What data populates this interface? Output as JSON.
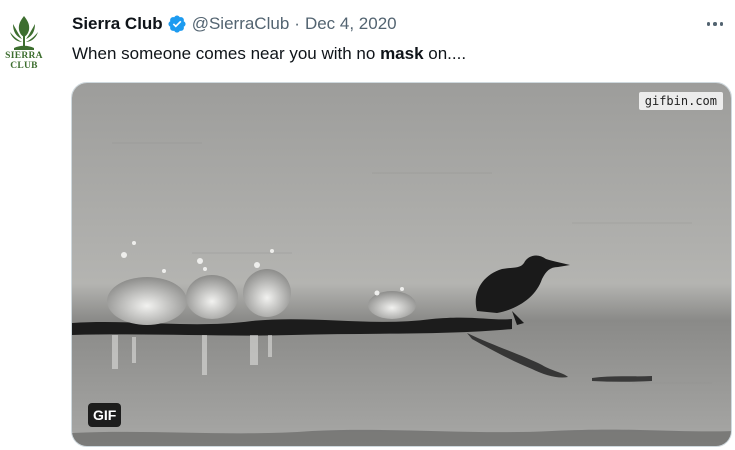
{
  "account": {
    "logo_line1": "SIERRA",
    "logo_line2": "CLUB",
    "name": "Sierra Club",
    "verified_icon": "verified-badge-icon",
    "handle": "@SierraClub",
    "separator": "·",
    "date": "Dec 4, 2020"
  },
  "tweet": {
    "text_before": "When someone comes near you with no ",
    "text_bold": "mask",
    "text_after": " on...."
  },
  "media": {
    "watermark": "gifbin.com",
    "badge": "GIF"
  },
  "colors": {
    "brand_green": "#3d6e2f",
    "verified_blue": "#1d9bf0",
    "secondary_text": "#536471"
  },
  "icons": {
    "more": "more-options-icon"
  }
}
